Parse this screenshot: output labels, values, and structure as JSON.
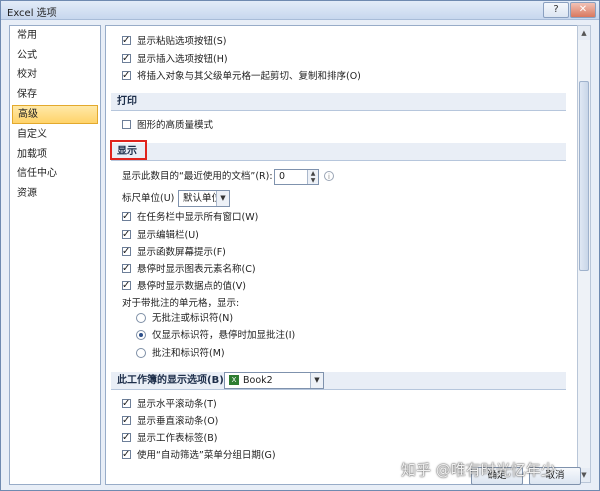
{
  "window": {
    "title": "Excel 选项",
    "help_label": "?",
    "close_label": "✕"
  },
  "sidebar": {
    "items": [
      {
        "label": "常用",
        "active": false
      },
      {
        "label": "公式",
        "active": false
      },
      {
        "label": "校对",
        "active": false
      },
      {
        "label": "保存",
        "active": false
      },
      {
        "label": "高级",
        "active": true
      },
      {
        "label": "自定义",
        "active": false
      },
      {
        "label": "加载项",
        "active": false
      },
      {
        "label": "信任中心",
        "active": false
      },
      {
        "label": "资源",
        "active": false
      }
    ]
  },
  "paste": {
    "show_paste_options": "显示粘贴选项按钮(S)",
    "show_insert_options": "显示插入选项按钮(H)",
    "cut_copy_sort": "将插入对象与其父级单元格一起剪切、复制和排序(O)"
  },
  "print_section": {
    "title": "打印",
    "high_quality_graphics": "图形的高质量模式"
  },
  "display_section": {
    "title": "显示",
    "recent_docs_label": "显示此数目的“最近使用的文档”(R):",
    "recent_docs_value": "0",
    "ruler_units_label": "标尺单位(U)",
    "ruler_units_value": "默认单位",
    "show_all_windows_taskbar": "在任务栏中显示所有窗口(W)",
    "show_formula_bar": "显示编辑栏(U)",
    "show_function_tooltips": "显示函数屏幕提示(F)",
    "show_chart_element_names": "悬停时显示图表元素名称(C)",
    "show_data_point_values": "悬停时显示数据点的值(V)",
    "comments_label": "对于带批注的单元格，显示:",
    "comment_none": "无批注或标识符(N)",
    "comment_indicator_only": "仅显示标识符，悬停时加显批注(I)",
    "comment_and_indicator": "批注和标识符(M)"
  },
  "workbook_section": {
    "title": "此工作簿的显示选项(B):",
    "workbook_value": "Book2",
    "show_hscroll": "显示水平滚动条(T)",
    "show_vscroll": "显示垂直滚动条(O)",
    "show_sheet_tabs": "显示工作表标签(B)",
    "group_dates": "使用“自动筛选”菜单分组日期(G)"
  },
  "footer": {
    "ok_label": "确定",
    "cancel_label": "取消"
  },
  "watermark": "知乎 @唯有时光忆年少",
  "colors": {
    "highlight_box": "#e0231d",
    "active_item": "#ffd36a"
  }
}
